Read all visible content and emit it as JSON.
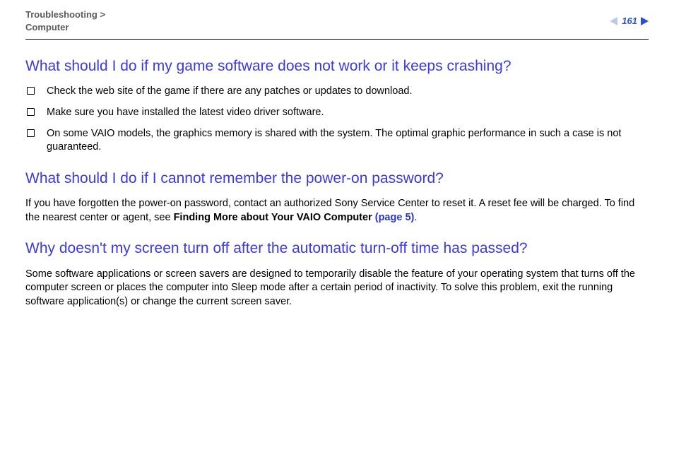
{
  "header": {
    "breadcrumb_section": "Troubleshooting",
    "breadcrumb_sep": " > ",
    "breadcrumb_sub": "Computer",
    "page_number": "161"
  },
  "sections": {
    "q1": {
      "heading": "What should I do if my game software does not work or it keeps crashing?",
      "bullets": [
        "Check the web site of the game if there are any patches or updates to download.",
        "Make sure you have installed the latest video driver software.",
        "On some VAIO models, the graphics memory is shared with the system. The optimal graphic performance in such a case is not guaranteed."
      ]
    },
    "q2": {
      "heading": "What should I do if I cannot remember the power-on password?",
      "body_pre": "If you have forgotten the power-on password, contact an authorized Sony Service Center to reset it. A reset fee will be charged. To find the nearest center or agent, see ",
      "body_bold": "Finding More about Your VAIO Computer ",
      "body_link": "(page 5)",
      "body_post": "."
    },
    "q3": {
      "heading": "Why doesn't my screen turn off after the automatic turn-off time has passed?",
      "body": "Some software applications or screen savers are designed to temporarily disable the feature of your operating system that turns off the computer screen or places the computer into Sleep mode after a certain period of inactivity. To solve this problem, exit the running software application(s) or change the current screen saver."
    }
  }
}
